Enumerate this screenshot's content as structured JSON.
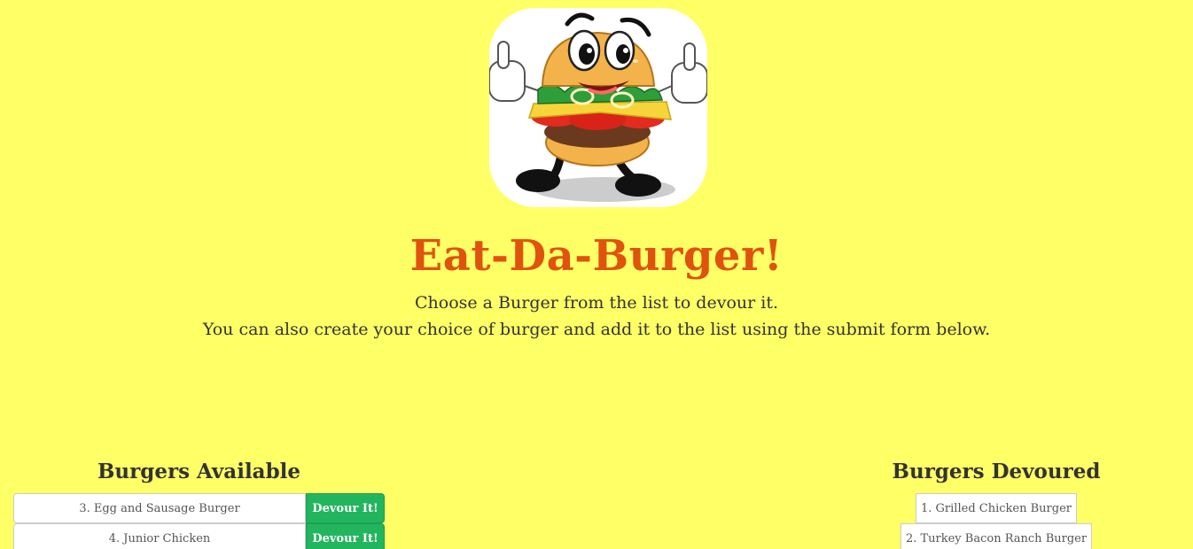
{
  "header": {
    "title": "Eat-Da-Burger!",
    "subtitle_line1": "Choose a Burger from the list to devour it.",
    "subtitle_line2": "You can also create your choice of burger and add it to the list using the submit form below."
  },
  "available": {
    "heading": "Burgers Available",
    "button_label": "Devour It!",
    "items": [
      {
        "label": "3. Egg and Sausage Burger"
      },
      {
        "label": "4. Junior Chicken"
      }
    ]
  },
  "devoured": {
    "heading": "Burgers Devoured",
    "items": [
      {
        "label": "1. Grilled Chicken Burger"
      },
      {
        "label": "2. Turkey Bacon Ranch Burger"
      }
    ]
  },
  "colors": {
    "background": "#ffff66",
    "title": "#e0530e",
    "button": "#22b55e"
  },
  "icons": {
    "logo": "cartoon-burger-mascot-icon"
  }
}
